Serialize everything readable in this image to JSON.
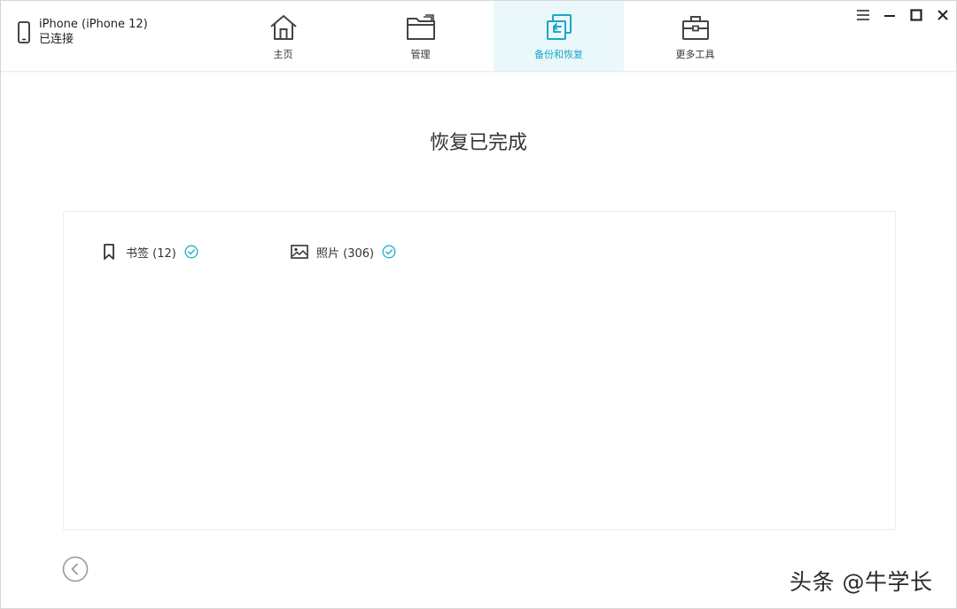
{
  "device": {
    "name": "iPhone (iPhone 12)",
    "status": "已连接",
    "icon": "phone-icon"
  },
  "tabs": [
    {
      "label": "主页",
      "icon": "home-icon",
      "active": false
    },
    {
      "label": "管理",
      "icon": "folder-icon",
      "active": false
    },
    {
      "label": "备份和恢复",
      "icon": "backup-restore-icon",
      "active": true
    },
    {
      "label": "更多工具",
      "icon": "toolbox-icon",
      "active": false
    }
  ],
  "window_controls": {
    "menu": "menu-icon",
    "minimize": "minimize-icon",
    "maximize": "maximize-icon",
    "close": "close-icon"
  },
  "main": {
    "title": "恢复已完成",
    "items": [
      {
        "label": "书签 (12)",
        "icon": "bookmark-icon",
        "status_icon": "check-circle-icon"
      },
      {
        "label": "照片 (306)",
        "icon": "image-icon",
        "status_icon": "check-circle-icon"
      }
    ],
    "back_icon": "back-arrow-icon"
  },
  "watermark": "头条 @牛学长",
  "colors": {
    "accent": "#1aa6c9",
    "active_tab_bg": "#eaf8fb",
    "check": "#2bb3c9",
    "border": "#ececec"
  }
}
